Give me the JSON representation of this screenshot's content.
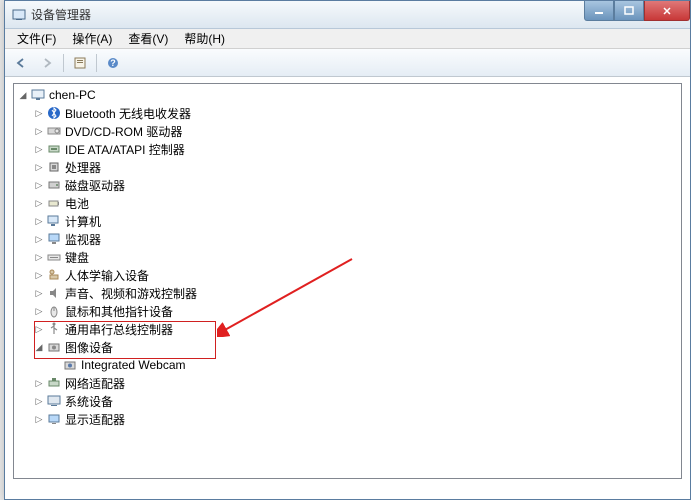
{
  "window": {
    "title": "设备管理器"
  },
  "menu": {
    "file": "文件(F)",
    "action": "操作(A)",
    "view": "查看(V)",
    "help": "帮助(H)"
  },
  "tree": {
    "root": "chen-PC",
    "nodes": {
      "bluetooth": "Bluetooth 无线电收发器",
      "dvd": "DVD/CD-ROM 驱动器",
      "ide": "IDE ATA/ATAPI 控制器",
      "cpu": "处理器",
      "disk": "磁盘驱动器",
      "battery": "电池",
      "computer": "计算机",
      "monitor": "监视器",
      "keyboard": "键盘",
      "hid": "人体学输入设备",
      "sound": "声音、视频和游戏控制器",
      "mouse": "鼠标和其他指针设备",
      "usb": "通用串行总线控制器",
      "imaging": "图像设备",
      "webcam": "Integrated Webcam",
      "network": "网络适配器",
      "system": "系统设备",
      "display": "显示适配器"
    }
  }
}
